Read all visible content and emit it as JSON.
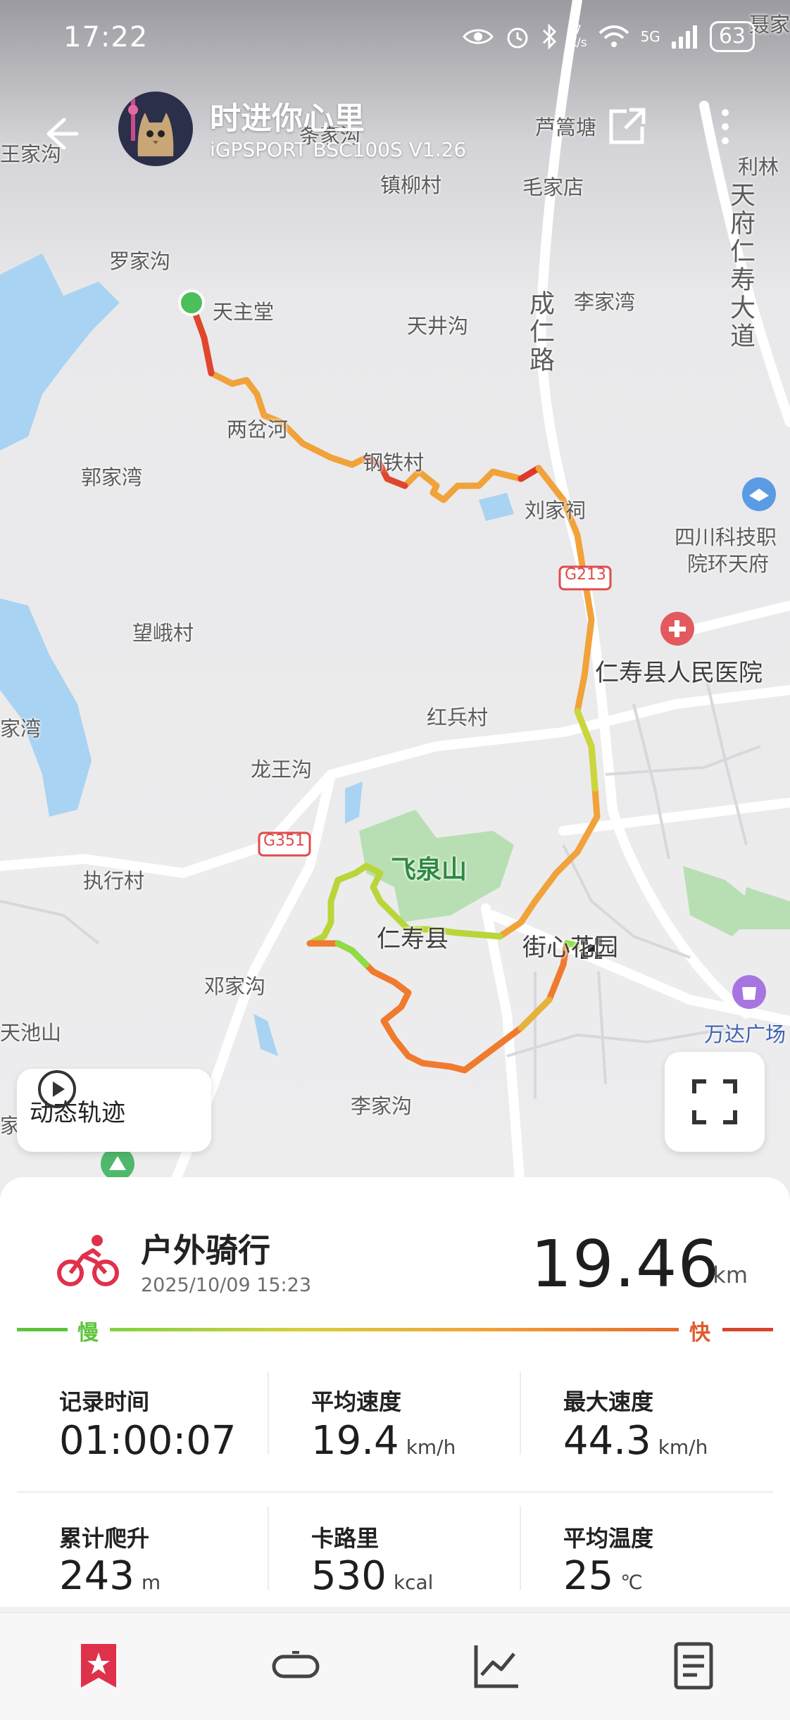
{
  "status_bar": {
    "time": "17:22",
    "net_speed_top": "7",
    "net_speed_bottom": "K/s",
    "signal": "5G",
    "battery": "63"
  },
  "header": {
    "title": "时进你心里",
    "subtitle": "iGPSPORT BSC100S  V1.26"
  },
  "map": {
    "labels": {
      "jia_top": "聂家",
      "wangjiagou": "王家沟",
      "tiaojiagou": "条家沟",
      "luweitang": "芦篙塘",
      "zhenliucun": "镇柳村",
      "maojiadian": "毛家店",
      "lilin": "利林",
      "tianfu": "天府仁寿大道",
      "luojiagou": "罗家沟",
      "tianzhutang": "天主堂",
      "tianjinggou": "天井沟",
      "lijiawan": "李家湾",
      "chengren": "成仁路",
      "lianghehe": "两岔河",
      "gangtiecun": "钢铁村",
      "guojiawan": "郭家湾",
      "liujiaci": "刘家祠",
      "sichuan1": "四川科技职",
      "sichuan2": "院环天府",
      "g213": "G213",
      "hospital": "仁寿县人民医院",
      "wangecun": "望峨村",
      "hongbingcun": "红兵村",
      "jiawan_left": "家湾",
      "longwanggou": "龙王沟",
      "g351": "G351",
      "feiquanshan": "飞泉山",
      "zhixingcun": "执行村",
      "renshouxian": "仁寿县",
      "jiexinhuayuan": "街心花园",
      "dengjiagou": "邓家沟",
      "wanda": "万达广场",
      "tianchishan": "天池山",
      "lijiagou": "李家沟",
      "jia_left": "家"
    }
  },
  "map_controls": {
    "dynamic_track_label": "动态轨迹"
  },
  "activity": {
    "type": "户外骑行",
    "datetime": "2025/10/09 15:23",
    "distance": "19.46",
    "distance_unit": "km",
    "slow_label": "慢",
    "fast_label": "快",
    "accent_color": "#e0314b"
  },
  "stats": {
    "duration": {
      "label": "记录时间",
      "value": "01:00:07",
      "unit": ""
    },
    "avg_speed": {
      "label": "平均速度",
      "value": "19.4",
      "unit": "km/h"
    },
    "max_speed": {
      "label": "最大速度",
      "value": "44.3",
      "unit": "km/h"
    },
    "climb": {
      "label": "累计爬升",
      "value": "243",
      "unit": "m"
    },
    "calories": {
      "label": "卡路里",
      "value": "530",
      "unit": "kcal"
    },
    "avg_temp": {
      "label": "平均温度",
      "value": "25",
      "unit": "℃"
    }
  },
  "tabs": {
    "items": [
      "favorite-icon",
      "device-icon",
      "chart-icon",
      "document-icon"
    ],
    "active_color": "#e0314b"
  }
}
